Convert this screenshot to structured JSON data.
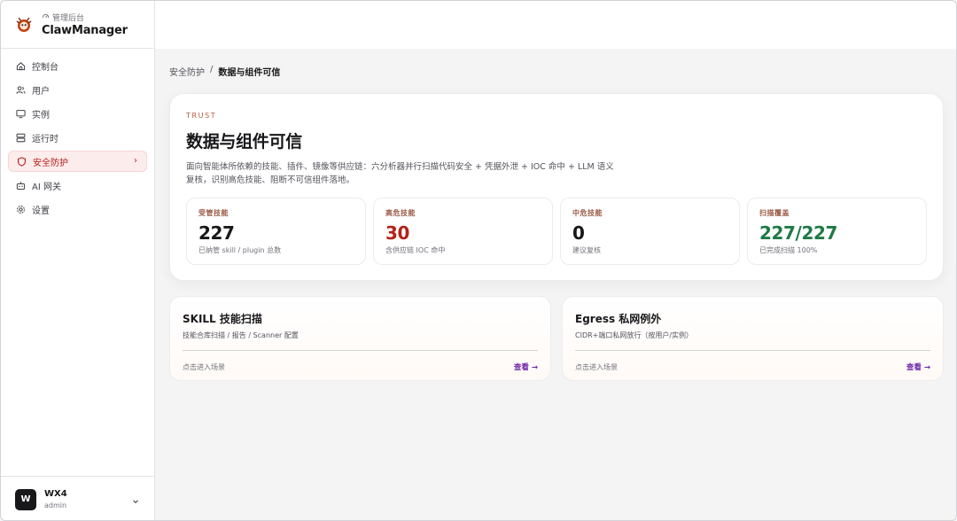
{
  "brand": {
    "subtitle": "管理后台",
    "name": "ClawManager"
  },
  "sidebar": {
    "items": [
      {
        "label": "控制台",
        "icon": "home-icon"
      },
      {
        "label": "用户",
        "icon": "users-icon"
      },
      {
        "label": "实例",
        "icon": "monitor-icon"
      },
      {
        "label": "运行时",
        "icon": "server-icon"
      },
      {
        "label": "安全防护",
        "icon": "shield-icon",
        "active": true
      },
      {
        "label": "AI 网关",
        "icon": "bot-icon"
      },
      {
        "label": "设置",
        "icon": "gear-icon"
      }
    ]
  },
  "user": {
    "initial": "W",
    "name": "WX4",
    "role": "admin"
  },
  "breadcrumb": {
    "parent": "安全防护",
    "separator": "/",
    "current": "数据与组件可信"
  },
  "hero": {
    "eyebrow": "TRUST",
    "title": "数据与组件可信",
    "description": "面向智能体所依赖的技能、插件、镜像等供应链：六分析器并行扫描代码安全 + 凭据外泄 + IOC 命中 + LLM 语义复核，识别高危技能、阻断不可信组件落地。"
  },
  "stats": [
    {
      "label": "受管技能",
      "value": "227",
      "note": "已纳管 skill / plugin 总数",
      "tone": "default"
    },
    {
      "label": "高危技能",
      "value": "30",
      "note": "含供应链 IOC 命中",
      "tone": "red"
    },
    {
      "label": "中危技能",
      "value": "0",
      "note": "建议复核",
      "tone": "default"
    },
    {
      "label": "扫描覆盖",
      "value": "227/227",
      "note": "已完成扫描 100%",
      "tone": "green"
    }
  ],
  "cards": [
    {
      "title": "SKILL 技能扫描",
      "subtitle": "技能合库扫描 / 报告 / Scanner 配置",
      "hint": "点击进入场景",
      "link": "查看 →"
    },
    {
      "title": "Egress 私网例外",
      "subtitle": "CIDR+端口私网放行（按用户/实例）",
      "hint": "点击进入场景",
      "link": "查看 →"
    }
  ],
  "colors": {
    "accent_red": "#b91c1c",
    "danger": "#b42318",
    "success": "#1e7a46",
    "link": "#6b21a8"
  }
}
